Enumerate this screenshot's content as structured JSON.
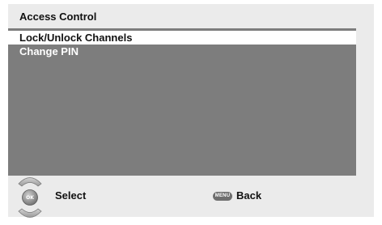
{
  "header": {
    "title": "Access Control"
  },
  "menu": {
    "items": [
      {
        "label": "Lock/Unlock Channels",
        "selected": true
      },
      {
        "label": "Change PIN",
        "selected": false
      }
    ]
  },
  "footer": {
    "ok_key_label": "OK",
    "select_label": "Select",
    "menu_key_label": "MENU",
    "back_label": "Back"
  },
  "icons": {
    "up": "arrow-up-icon",
    "down": "arrow-down-icon",
    "ok": "ok-button-icon",
    "menu": "menu-button-icon"
  },
  "colors": {
    "background": "#ebebeb",
    "panel": "#7d7d7d",
    "highlight": "#ffffff"
  }
}
